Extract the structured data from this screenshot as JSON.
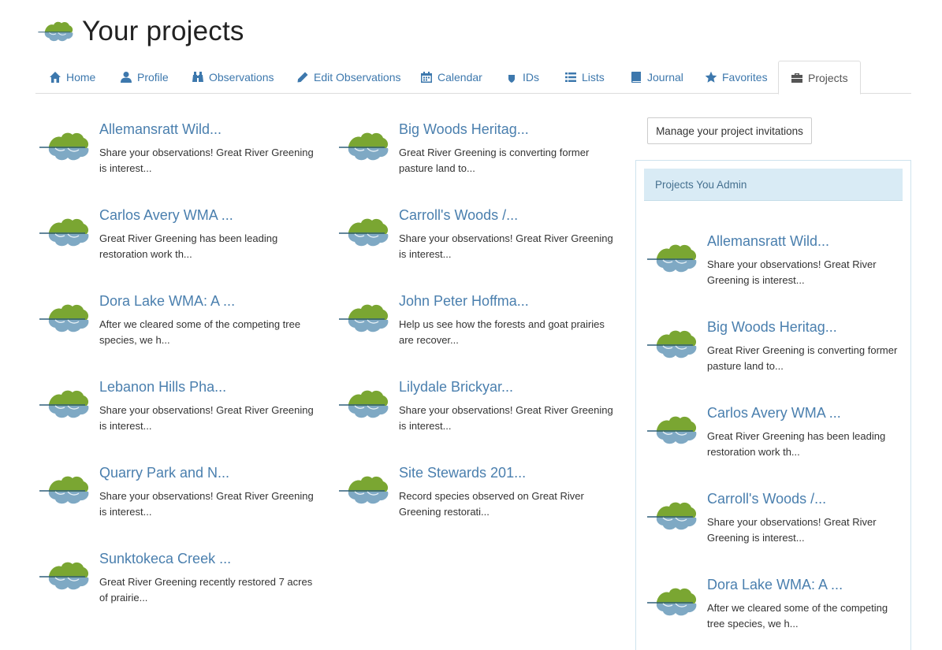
{
  "header": {
    "title": "Your projects",
    "logo_icon": "leaf-logo-icon"
  },
  "tabs": [
    {
      "label": "Home",
      "icon": "home-icon"
    },
    {
      "label": "Profile",
      "icon": "user-icon"
    },
    {
      "label": "Observations",
      "icon": "binoculars-icon"
    },
    {
      "label": "Edit Observations",
      "icon": "pencil-icon"
    },
    {
      "label": "Calendar",
      "icon": "calendar-icon"
    },
    {
      "label": "IDs",
      "icon": "shield-icon"
    },
    {
      "label": "Lists",
      "icon": "list-icon"
    },
    {
      "label": "Journal",
      "icon": "book-icon"
    },
    {
      "label": "Favorites",
      "icon": "star-icon"
    },
    {
      "label": "Projects",
      "icon": "briefcase-icon",
      "active": true
    }
  ],
  "projects": [
    {
      "title": "Allemansratt Wild...",
      "desc": "Share your observations! Great River Greening is interest..."
    },
    {
      "title": "Big Woods Heritag...",
      "desc": "Great River Greening is converting former pasture land to..."
    },
    {
      "title": "Carlos Avery WMA ...",
      "desc": "Great River Greening has been leading restoration work th..."
    },
    {
      "title": "Carroll's Woods /...",
      "desc": "Share your observations! Great River Greening is interest..."
    },
    {
      "title": "Dora Lake WMA: A ...",
      "desc": "After we cleared some of the competing tree species, we h..."
    },
    {
      "title": "John Peter Hoffma...",
      "desc": "Help us see how the forests and goat prairies are recover..."
    },
    {
      "title": "Lebanon Hills Pha...",
      "desc": "Share your observations! Great River Greening is interest..."
    },
    {
      "title": "Lilydale Brickyar...",
      "desc": "Share your observations! Great River Greening is interest..."
    },
    {
      "title": "Quarry Park and N...",
      "desc": "Share your observations! Great River Greening is interest..."
    },
    {
      "title": "Site Stewards 201...",
      "desc": "Record species observed on Great River Greening restorati..."
    },
    {
      "title": "Sunktokeca Creek ...",
      "desc": "Great River Greening recently restored 7 acres of prairie..."
    }
  ],
  "manage_button": "Manage your project invitations",
  "admin": {
    "heading": "Projects You Admin",
    "projects": [
      {
        "title": "Allemansratt Wild...",
        "desc": "Share your observations! Great River Greening is interest..."
      },
      {
        "title": "Big Woods Heritag...",
        "desc": "Great River Greening is converting former pasture land to..."
      },
      {
        "title": "Carlos Avery WMA ...",
        "desc": "Great River Greening has been leading restoration work th..."
      },
      {
        "title": "Carroll's Woods /...",
        "desc": "Share your observations! Great River Greening is interest..."
      },
      {
        "title": "Dora Lake WMA: A ...",
        "desc": "After we cleared some of the competing tree species, we h..."
      }
    ]
  },
  "colors": {
    "link": "#4a7fae",
    "tab_link": "#3d78ad",
    "leaf_green": "#7aa632",
    "water_blue": "#7fa9c4",
    "admin_header_bg": "#d9ebf5"
  }
}
